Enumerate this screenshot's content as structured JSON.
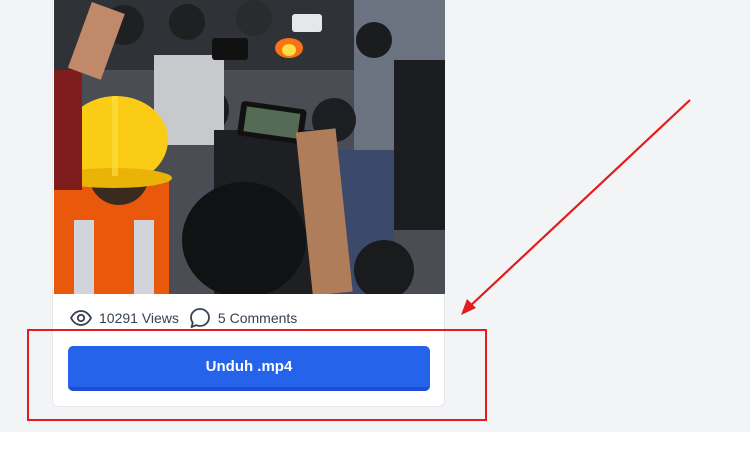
{
  "card": {
    "thumbnail_icon": "video-thumbnail",
    "stats": {
      "views_icon": "eye-icon",
      "views_text": "10291 Views",
      "comments_icon": "comment-icon",
      "comments_text": "5 Comments"
    },
    "download_button_label": "Unduh .mp4"
  },
  "annotation": {
    "color": "#e11d1d",
    "type": "red-arrow-and-box"
  },
  "colors": {
    "button": "#2563eb",
    "button_shadow": "#1d4ed8",
    "page_background": "#f3f4f6"
  }
}
